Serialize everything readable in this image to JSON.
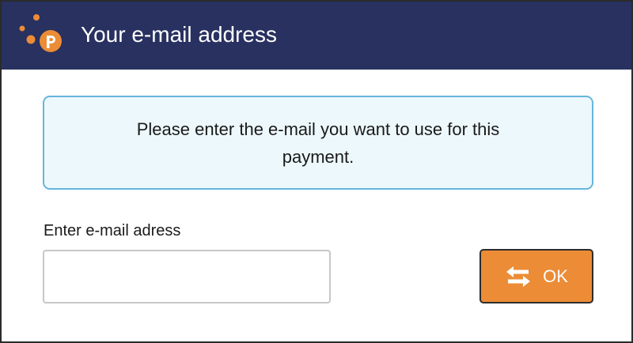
{
  "header": {
    "title": "Your e-mail address",
    "logo_icon": "payment-logo-icon",
    "background_color": "#283160"
  },
  "info_box": {
    "message": "Please enter the e-mail you want to use for this payment."
  },
  "form": {
    "email_label": "Enter e-mail adress",
    "email_value": "",
    "email_placeholder": ""
  },
  "ok_button": {
    "label": "OK",
    "icon": "swap-arrows-icon",
    "color": "#ec8c36"
  },
  "colors": {
    "accent": "#ec8c36",
    "info_border": "#67b5de",
    "info_background": "#edf8fc"
  }
}
